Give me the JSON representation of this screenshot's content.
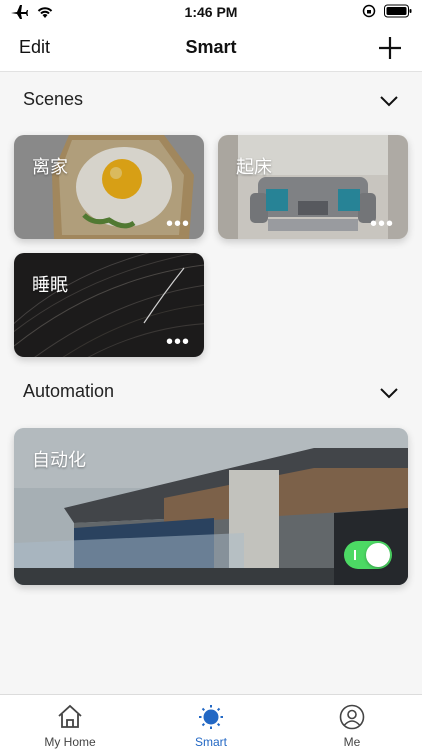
{
  "status_bar": {
    "time": "1:46 PM"
  },
  "nav": {
    "edit_label": "Edit",
    "title": "Smart",
    "add_icon": "plus-icon"
  },
  "scenes": {
    "title": "Scenes",
    "items": [
      {
        "label": "离家",
        "more": "•••"
      },
      {
        "label": "起床",
        "more": "•••"
      },
      {
        "label": "睡眠",
        "more": "•••"
      }
    ]
  },
  "automation": {
    "title": "Automation",
    "items": [
      {
        "label": "自动化",
        "enabled": true
      }
    ]
  },
  "tabs": [
    {
      "label": "My Home",
      "icon": "home-icon",
      "active": false
    },
    {
      "label": "Smart",
      "icon": "sun-icon",
      "active": true
    },
    {
      "label": "Me",
      "icon": "person-icon",
      "active": false
    }
  ],
  "colors": {
    "accent": "#2368c4",
    "toggle_on": "#4cd964"
  }
}
